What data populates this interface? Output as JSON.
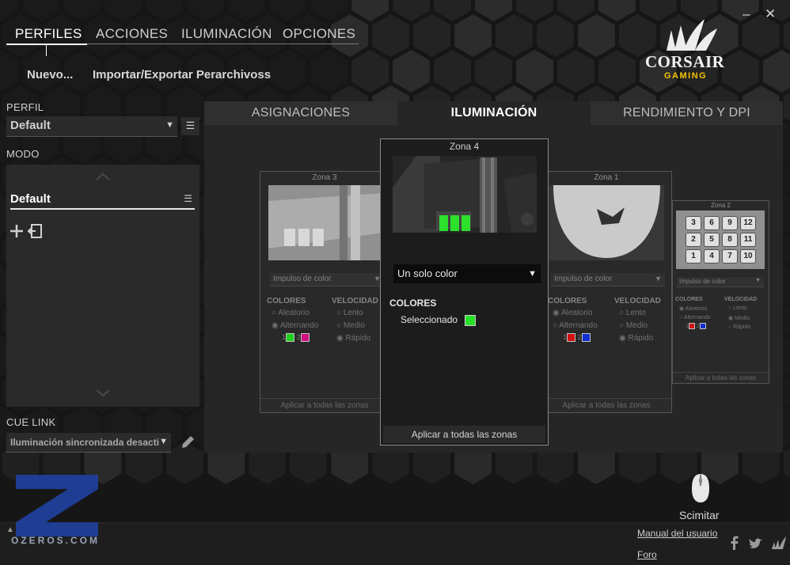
{
  "window": {
    "minimize_label": "–",
    "close_label": "✕"
  },
  "top_nav": {
    "tabs": [
      "PERFILES",
      "ACCIONES",
      "ILUMINACIÓN",
      "OPCIONES"
    ],
    "active": "PERFILES"
  },
  "sub_nav": {
    "new_label": "Nuevo...",
    "import_export_label": "Importar/Exportar Perarchivoss"
  },
  "brand": {
    "name": "CORSAIR",
    "tagline": "GAMING",
    "accent": "#f5c400"
  },
  "profile": {
    "label": "PERFIL",
    "value": "Default",
    "menu_icon": "menu-icon"
  },
  "mode": {
    "label": "MODO",
    "items": [
      {
        "name": "Default"
      }
    ],
    "add_icon": "plus-icon",
    "import_icon": "import-icon"
  },
  "cue_link": {
    "label": "CUE LINK",
    "value": "Iluminación sincronizada desacti",
    "edit_icon": "pencil-icon"
  },
  "main_tabs": {
    "items": [
      "ASIGNACIONES",
      "ILUMINACIÓN",
      "RENDIMIENTO Y DPI"
    ],
    "active": "ILUMINACIÓN"
  },
  "zones": {
    "zone3": {
      "title": "Zona 3",
      "effect": "Impulso de color",
      "colors_label": "COLORES",
      "speed_label": "VELOCIDAD",
      "color_options": [
        "Aleatorio",
        "Alternando"
      ],
      "speed_options": [
        "Lento",
        "Medio",
        "Rápido"
      ],
      "color1_num": "1",
      "color2_num": "2",
      "color1": "#1fe01f",
      "color2": "#e0108a",
      "apply": "Aplicar a todas las zonas"
    },
    "zone4": {
      "title": "Zona 4",
      "effect": "Un solo color",
      "colors_label": "COLORES",
      "selected_label": "Seleccionado",
      "selected_color": "#27e027",
      "apply": "Aplicar a todas las zonas"
    },
    "zone1": {
      "title": "Zona 1",
      "effect": "Impulso de color",
      "colors_label": "COLORES",
      "speed_label": "VELOCIDAD",
      "color_options": [
        "Aleatorio",
        "Alternando"
      ],
      "speed_options": [
        "Lento",
        "Medio",
        "Rápido"
      ],
      "color1_num": "1",
      "color2_num": "2",
      "color1": "#e01010",
      "color2": "#1030e0",
      "apply": "Aplicar a todas las zonas"
    },
    "zone2": {
      "title": "Zona 2",
      "effect": "Impulso de color",
      "colors_label": "COLORES",
      "speed_label": "VELOCIDAD",
      "color_options": [
        "Aleatorio",
        "Alternando"
      ],
      "speed_options": [
        "Lento",
        "Medio",
        "Rápido"
      ],
      "color1_num": "1",
      "color2_num": "2",
      "color1": "#e01010",
      "color2": "#1030e0",
      "keys": [
        "3",
        "6",
        "9",
        "12",
        "2",
        "5",
        "8",
        "11",
        "1",
        "4",
        "7",
        "10"
      ],
      "apply": "Aplicar a todas las zonas"
    }
  },
  "device": {
    "name": "Scimitar",
    "icon": "mouse-icon"
  },
  "footer": {
    "manual_label": "Manual del usuario",
    "forum_label": "Foro",
    "social": [
      "facebook-icon",
      "twitter-icon",
      "corsair-icon"
    ]
  },
  "watermark": {
    "text": "OZEROS.COM",
    "letter": "Z",
    "color": "#1f3f9a"
  }
}
